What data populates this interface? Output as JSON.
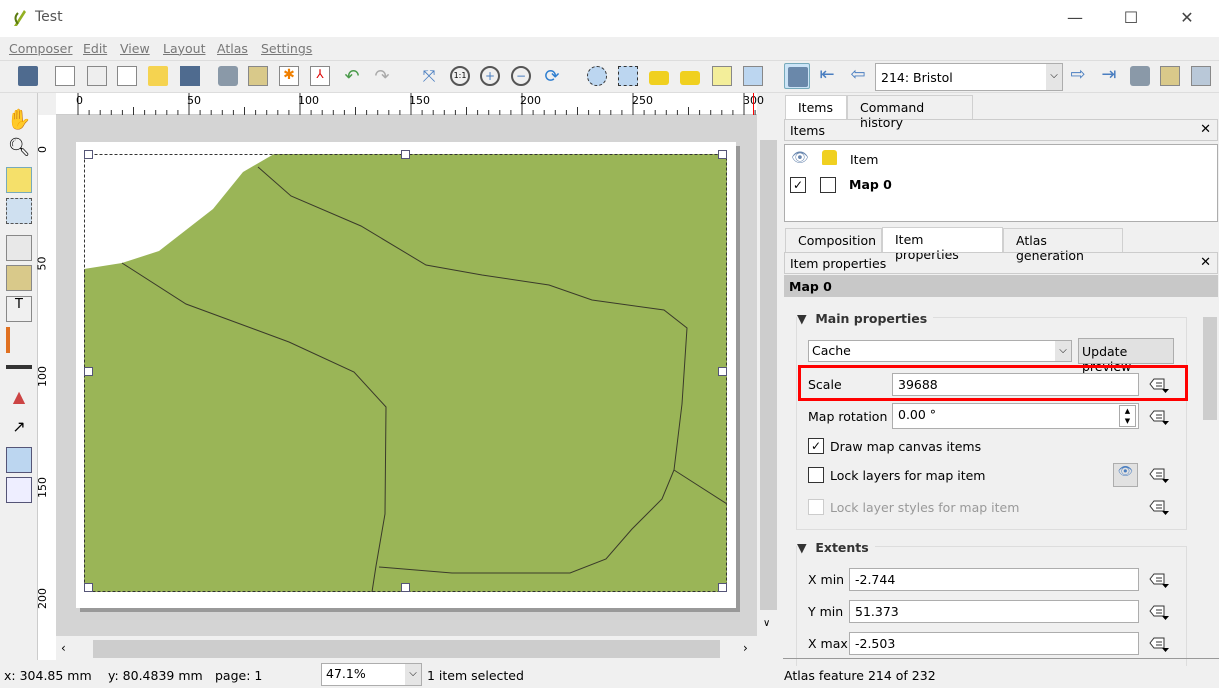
{
  "window": {
    "title": "Test",
    "minimize": "—",
    "maximize": "☐",
    "close": "✕"
  },
  "menu": [
    "Composer",
    "Edit",
    "View",
    "Layout",
    "Atlas",
    "Settings"
  ],
  "atlas": {
    "feature_select": "214: Bristol"
  },
  "ruler": {
    "h": [
      "0",
      "50",
      "100",
      "150",
      "200",
      "250",
      "300"
    ],
    "v": [
      "0",
      "50",
      "100",
      "150",
      "200"
    ]
  },
  "map": {
    "fill": "#9ab557",
    "stroke": "#3a3a2a"
  },
  "status": {
    "x": "x: 304.85 mm",
    "y": "y: 80.4839 mm",
    "page": "page: 1",
    "zoom": "47.1%",
    "selection": "1 item selected",
    "atlas_feature": "Atlas feature 214 of 232"
  },
  "panel": {
    "top_tabs": [
      "Items",
      "Command history"
    ],
    "items_title": "Items",
    "items_header": "Item",
    "items": [
      {
        "name": "Map 0",
        "visible": true,
        "locked": false
      }
    ],
    "bottom_tabs": [
      "Composition",
      "Item properties",
      "Atlas generation"
    ],
    "props_title": "Item properties",
    "item_name": "Map 0",
    "main_properties": "Main properties",
    "cache_select": "Cache",
    "update_preview": "Update preview",
    "scale_label": "Scale",
    "scale": "39688",
    "rotation_label": "Map rotation",
    "rotation": "0.00 °",
    "draw_canvas": "Draw map canvas items",
    "draw_canvas_checked": true,
    "lock_layers": "Lock layers for map item",
    "lock_layers_checked": false,
    "lock_styles": "Lock layer styles for map item",
    "lock_styles_checked": false,
    "extents": "Extents",
    "xmin_label": "X min",
    "xmin": "-2.744",
    "ymin_label": "Y min",
    "ymin": "51.373",
    "xmax_label": "X max",
    "xmax": "-2.503"
  },
  "colors": {
    "highlight": "#ff0000",
    "accent": "#4a7ec0"
  }
}
